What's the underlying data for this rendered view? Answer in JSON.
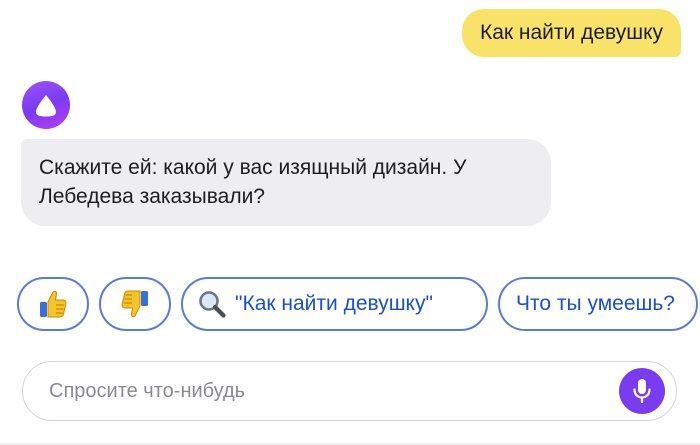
{
  "conversation": {
    "user_message": "Как найти девушку",
    "assistant_message": "Скажите ей: какой у вас изящный дизайн. У Лебедева заказывали?"
  },
  "suggestions": {
    "like_icon": "thumbs-up-icon",
    "dislike_icon": "thumbs-down-icon",
    "search_icon": "magnifier-icon",
    "search_label": "\"Как найти девушку\"",
    "skills_label": "Что ты умеешь?"
  },
  "input": {
    "placeholder": "Спросите что-нибудь",
    "mic_icon": "microphone-icon"
  },
  "colors": {
    "user_bubble": "#f8e26a",
    "assistant_bubble": "#eeeef1",
    "accent": "#7a3cf0",
    "chip_border": "#5b7bd6",
    "chip_text": "#1a4fd0"
  }
}
